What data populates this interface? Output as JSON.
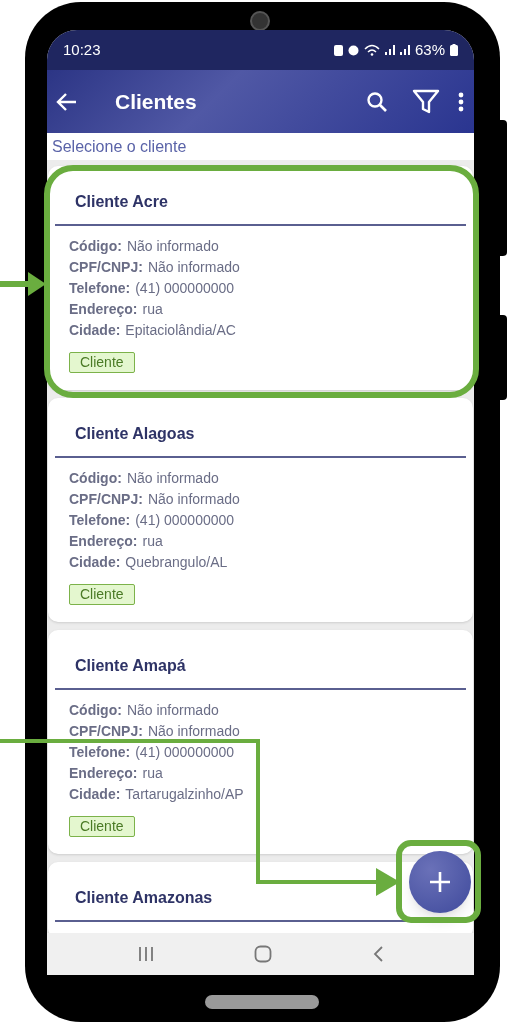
{
  "status_bar": {
    "time": "10:23",
    "battery": "63%"
  },
  "app_bar": {
    "title": "Clientes"
  },
  "subtitle": "Selecione o cliente",
  "clients": [
    {
      "name": "Cliente Acre",
      "fields": [
        {
          "label": "Código:",
          "value": "Não informado"
        },
        {
          "label": "CPF/CNPJ:",
          "value": "Não informado"
        },
        {
          "label": "Telefone:",
          "value": "(41) 000000000"
        },
        {
          "label": "Endereço:",
          "value": "rua"
        },
        {
          "label": "Cidade:",
          "value": "Epitaciolândia/AC"
        }
      ],
      "tag": "Cliente"
    },
    {
      "name": "Cliente Alagoas",
      "fields": [
        {
          "label": "Código:",
          "value": "Não informado"
        },
        {
          "label": "CPF/CNPJ:",
          "value": "Não informado"
        },
        {
          "label": "Telefone:",
          "value": "(41) 000000000"
        },
        {
          "label": "Endereço:",
          "value": "rua"
        },
        {
          "label": "Cidade:",
          "value": "Quebrangulo/AL"
        }
      ],
      "tag": "Cliente"
    },
    {
      "name": "Cliente Amapá",
      "fields": [
        {
          "label": "Código:",
          "value": "Não informado"
        },
        {
          "label": "CPF/CNPJ:",
          "value": "Não informado"
        },
        {
          "label": "Telefone:",
          "value": "(41) 000000000"
        },
        {
          "label": "Endereço:",
          "value": "rua"
        },
        {
          "label": "Cidade:",
          "value": "Tartarugalzinho/AP"
        }
      ],
      "tag": "Cliente"
    },
    {
      "name": "Cliente Amazonas"
    }
  ]
}
